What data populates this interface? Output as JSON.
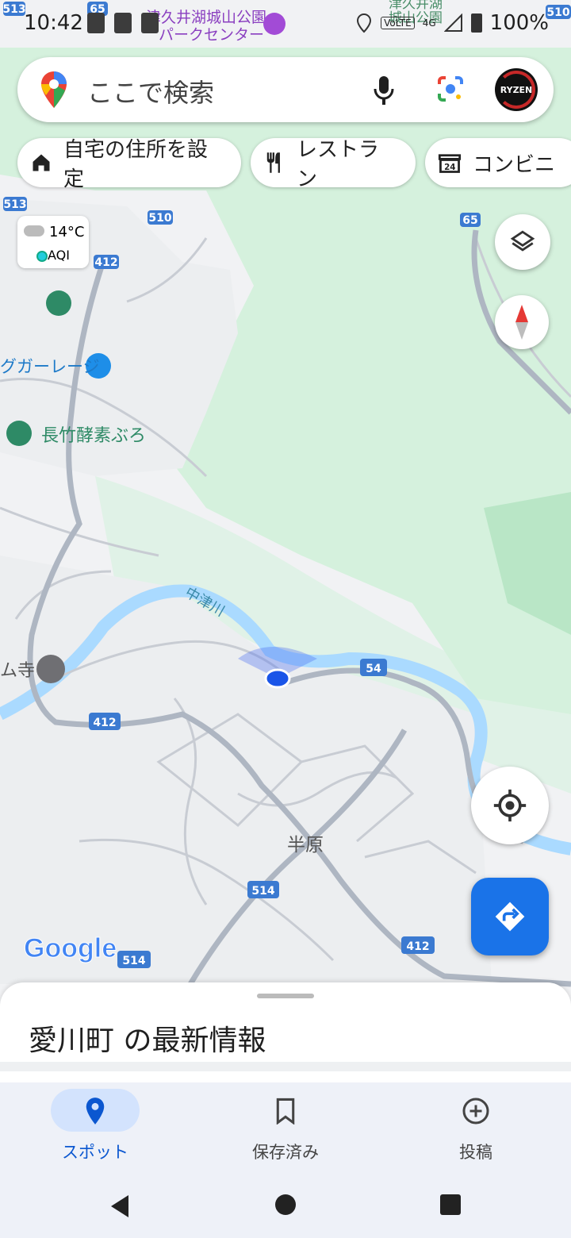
{
  "status_bar": {
    "time": "10:42",
    "network": "VoLTE",
    "signal_type": "4G",
    "battery": "100%"
  },
  "search": {
    "placeholder": "ここで検索",
    "icons": [
      "google-maps-pin-icon",
      "mic-icon",
      "google-lens-icon"
    ],
    "avatar_text": "RYZEN"
  },
  "chips": [
    {
      "label": "自宅の住所を設定",
      "icon": "home-icon"
    },
    {
      "label": "レストラン",
      "icon": "restaurant-icon"
    },
    {
      "label": "コンビニ",
      "icon": "convenience-store-icon"
    }
  ],
  "weather": {
    "temperature": "14°C",
    "aqi_label": "AQI"
  },
  "map_labels": {
    "park_center": [
      "津久井湖城山公園",
      "パークセンター"
    ],
    "park_top_right": [
      "津久井湖",
      "城山公園"
    ],
    "garage": "グガーレージ",
    "onsen": "長竹酵素ぶろ",
    "river": "中津川",
    "temple": "ム寺",
    "area": "半原",
    "roads": [
      "513",
      "65",
      "513",
      "510",
      "412",
      "65",
      "510",
      "54",
      "412",
      "514",
      "514",
      "412"
    ]
  },
  "google_logo": "Google",
  "bottom_sheet": {
    "title": "愛川町 の最新情報"
  },
  "bottom_nav": [
    {
      "label": "スポット",
      "icon": "location-pin-icon",
      "active": true
    },
    {
      "label": "保存済み",
      "icon": "bookmark-icon",
      "active": false
    },
    {
      "label": "投稿",
      "icon": "add-circle-icon",
      "active": false
    }
  ],
  "system_nav": [
    "back-icon",
    "home-icon",
    "recents-icon"
  ],
  "colors": {
    "accent": "#1a73e8",
    "green_area": "#d3f0dc",
    "river": "#aadaff",
    "road_highway": "#3b7ad1",
    "active_pill": "#d3e3fd"
  }
}
